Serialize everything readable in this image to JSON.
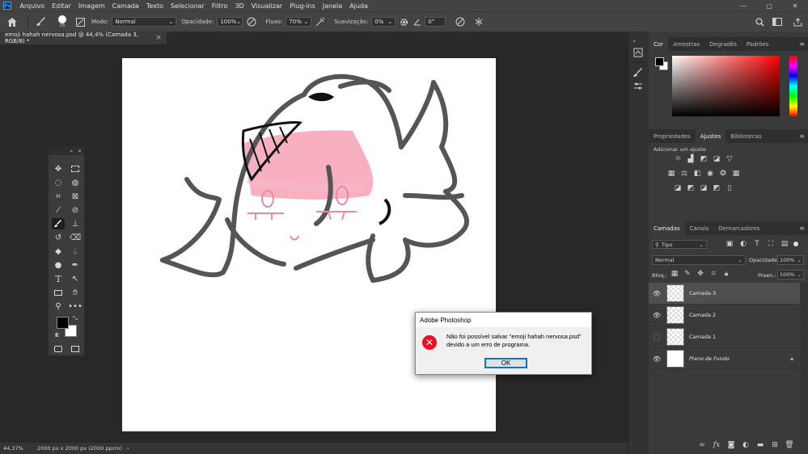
{
  "app": {
    "logo": "Ps"
  },
  "menu": [
    "Arquivo",
    "Editar",
    "Imagem",
    "Camada",
    "Texto",
    "Selecionar",
    "Filtro",
    "3D",
    "Visualizar",
    "Plug-ins",
    "Janela",
    "Ajuda"
  ],
  "window_controls": [
    "—",
    "▢",
    "✕"
  ],
  "options": {
    "brush_size": "25",
    "mode_label": "Modo:",
    "mode_value": "Normal",
    "opacity_label": "Opacidade:",
    "opacity_value": "100%",
    "flow_label": "Fluxo:",
    "flow_value": "70%",
    "smoothing_label": "Suavização:",
    "smoothing_value": "0%",
    "angle_value": "0°"
  },
  "document": {
    "tab_title": "emoji hahah nervosa.psd @ 44,4% (Camada 3, RGB/8) *",
    "close": "×"
  },
  "status": {
    "zoom": "44,37%",
    "doc_info": "2000 px x 2000 px (2000 ppcm)",
    "arrow": "›"
  },
  "color_panel": {
    "tabs": [
      "Cor",
      "Amostras",
      "Degradês",
      "Padrões"
    ],
    "active": "Cor"
  },
  "adjust_panel": {
    "tabs": [
      "Propriedades",
      "Ajustes",
      "Bibliotecas"
    ],
    "active": "Ajustes",
    "heading": "Adicionar um ajuste"
  },
  "layers_panel": {
    "tabs": [
      "Camadas",
      "Canais",
      "Demarcadores"
    ],
    "active": "Camadas",
    "filter_value": "Tipo",
    "blend_mode": "Normal",
    "opacity_label": "Opacidade:",
    "opacity_value": "100%",
    "lock_label": "Bloq.:",
    "fill_label": "Preen.:",
    "fill_value": "100%",
    "layers": [
      {
        "name": "Camada 3",
        "visible": true,
        "active": true
      },
      {
        "name": "Camada 2",
        "visible": true,
        "active": false
      },
      {
        "name": "Camada 1",
        "visible": false,
        "active": false
      },
      {
        "name": "Plano de Fundo",
        "visible": true,
        "active": false,
        "locked": true
      }
    ],
    "footer_icons": [
      "link-icon",
      "fx-icon",
      "mask-icon",
      "adjustment-icon",
      "group-icon",
      "new-layer-icon",
      "trash-icon"
    ]
  },
  "dialog": {
    "title": "Adobe Photoshop",
    "message": "Não foi possível salvar \"emoji hahah nervosa.psd\"\ndevido a um erro de programa.",
    "ok": "OK"
  },
  "colors": {
    "foreground": "#000000",
    "background": "#ffffff",
    "accent": "#31a8ff",
    "error": "#e81123"
  }
}
